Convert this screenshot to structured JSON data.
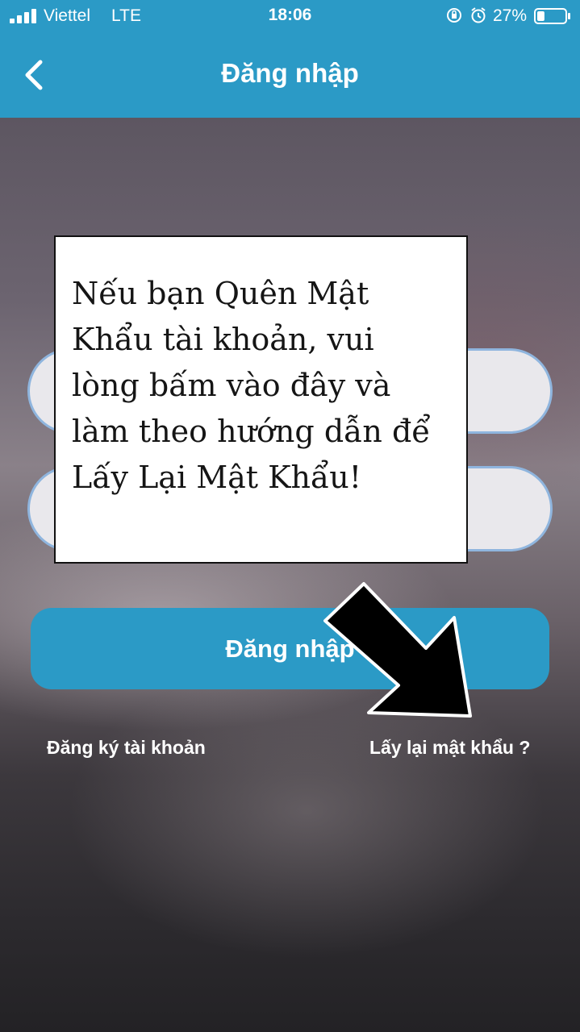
{
  "status_bar": {
    "carrier": "Viettel",
    "network": "LTE",
    "time": "18:06",
    "battery_percent": "27%",
    "battery_level": 0.27,
    "icons": [
      "signal-icon",
      "orientation-lock-icon",
      "alarm-icon",
      "battery-icon"
    ]
  },
  "nav": {
    "title": "Đăng nhập",
    "back_icon": "chevron-left-icon"
  },
  "form": {
    "username_value": "",
    "password_value": "",
    "login_button": "Đăng nhập",
    "register_link": "Đăng ký tài khoản",
    "forgot_link": "Lấy lại mật khẩu ?"
  },
  "annotation": {
    "lines": [
      "Nếu bạn Quên Mật",
      "Khẩu tài khoản, vui",
      "lòng bấm vào đây và",
      "làm theo hướng dẫn để",
      "Lấy Lại Mật Khẩu!"
    ],
    "arrow_icon": "arrow-down-right-icon"
  },
  "colors": {
    "accent": "#2b9ac6",
    "input_border": "#8fb5de",
    "input_fill": "#e9e8ec",
    "annotation_text": "#151515"
  }
}
